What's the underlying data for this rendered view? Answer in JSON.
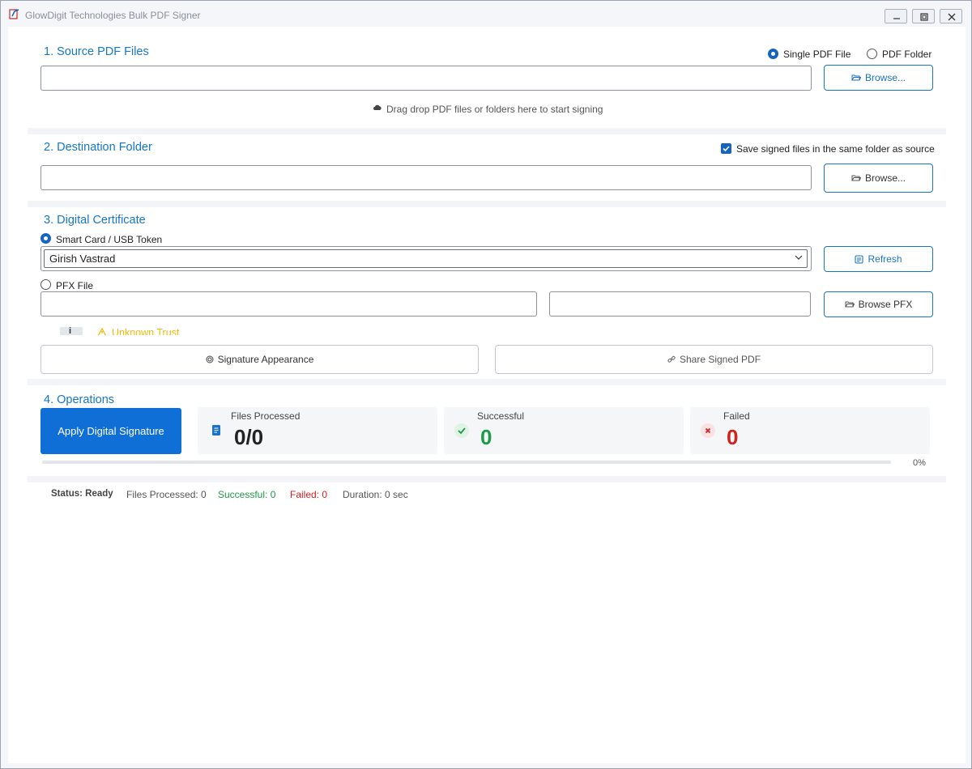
{
  "window": {
    "title": "GlowDigit Technologies Bulk PDF Signer"
  },
  "source": {
    "title": "1. Source PDF Files",
    "mode_single_label": "Single PDF File",
    "mode_folder_label": "PDF Folder",
    "selected_mode": "single",
    "path_value": "",
    "browse_label": "Browse...",
    "drop_hint": "Drag  drop PDF files or folders here to start signing"
  },
  "destination": {
    "title": "2. Destination Folder",
    "same_folder_label": "Save signed files in the same folder as source",
    "same_folder_checked": true,
    "path_value": "",
    "browse_label": "Browse..."
  },
  "certificate": {
    "title": "3. Digital Certificate",
    "smartcard_label": "Smart Card / USB Token",
    "selected_source": "smartcard",
    "token_selected": "Girish Vastrad",
    "refresh_label": "Refresh",
    "pfx_label": "PFX File",
    "pfx_path_value": "",
    "pfx_password_value": "",
    "browse_pfx_label": "Browse PFX",
    "info_badge": "i",
    "trust_label": "Unknown Trust",
    "appearance_label": "Signature Appearance",
    "share_label": "Share Signed PDF"
  },
  "operations": {
    "title": "4. Operations",
    "apply_label": "Apply Digital Signature",
    "files_processed_label": "Files Processed",
    "files_processed_value": "0/0",
    "successful_label": "Successful",
    "successful_value": "0",
    "failed_label": "Failed",
    "failed_value": "0",
    "progress_percent": 0,
    "progress_text": "0%"
  },
  "statusbar": {
    "status": "Status: Ready",
    "files_processed": "Files Processed: 0",
    "successful": "Successful: 0",
    "failed": "Failed: 0",
    "duration": "Duration: 0 sec"
  },
  "colors": {
    "accent": "#1a73c8",
    "primary_button": "#0f6fd6",
    "success": "#1e9a45",
    "error": "#d32020",
    "warning": "#f2b90f"
  }
}
